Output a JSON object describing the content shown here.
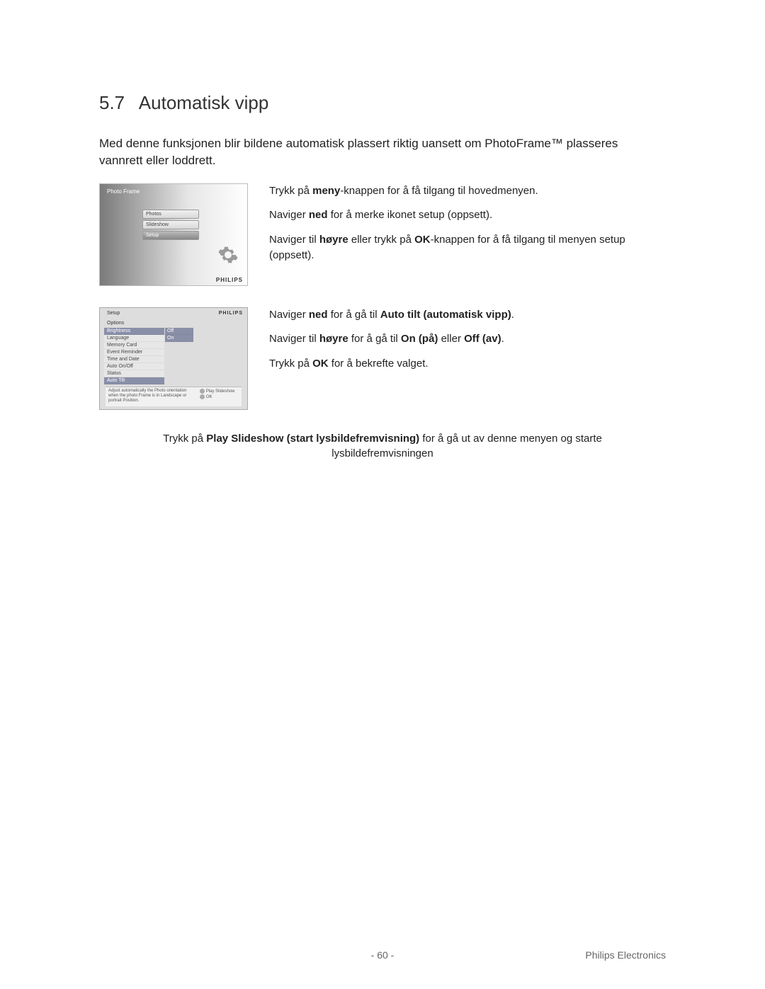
{
  "section": {
    "number": "5.7",
    "title": "Automatisk vipp"
  },
  "intro": "Med denne funksjonen blir bildene automatisk plassert riktig uansett om PhotoFrame™ plasseres vannrett eller loddrett.",
  "screenshot1": {
    "title": "Photo Frame",
    "menu": [
      "Photos",
      "Slideshow",
      "Setup"
    ],
    "brand": "PHILIPS"
  },
  "instr1": {
    "l1a": "Trykk på ",
    "l1b": "meny",
    "l1c": "-knappen for å få tilgang til hovedmenyen.",
    "l2a": "Naviger ",
    "l2b": "ned",
    "l2c": " for å merke ikonet setup (oppsett).",
    "l3a": "Naviger til ",
    "l3b": "høyre",
    "l3c": " eller trykk på ",
    "l3d": "OK",
    "l3e": "-knappen for å få tilgang til menyen setup (oppsett)."
  },
  "screenshot2": {
    "title": "Setup",
    "brand": "PHILIPS",
    "subtitle": "Options",
    "left_items": [
      "Brightness",
      "Language",
      "Memory Card",
      "Event Reminder",
      "Time and Date",
      "Auto On/Off",
      "Status",
      "Auto Tilt"
    ],
    "right_items": [
      "Off",
      "On"
    ],
    "footer_text": "Adjust automatically the Photo orientation when the photo Frame is in Landscape or portrait Position.",
    "footer_play": "Play Slideshow",
    "footer_ok": "OK"
  },
  "instr2": {
    "l1a": "Naviger ",
    "l1b": "ned",
    "l1c": " for å gå til ",
    "l1d": "Auto tilt (automatisk vipp)",
    "l1e": ".",
    "l2a": "Naviger til ",
    "l2b": "høyre",
    "l2c": " for å gå til ",
    "l2d": "On (på)",
    "l2e": " eller ",
    "l2f": "Off (av)",
    "l2g": ".",
    "l3a": "Trykk på ",
    "l3b": "OK",
    "l3c": " for å bekrefte valget."
  },
  "final": {
    "a": "Trykk på ",
    "b": "Play Slideshow (start lysbildefremvisning)",
    "c": " for å gå ut av denne menyen og starte lysbildefremvisningen"
  },
  "footer": {
    "page": "- 60 -",
    "brand": "Philips Electronics"
  }
}
